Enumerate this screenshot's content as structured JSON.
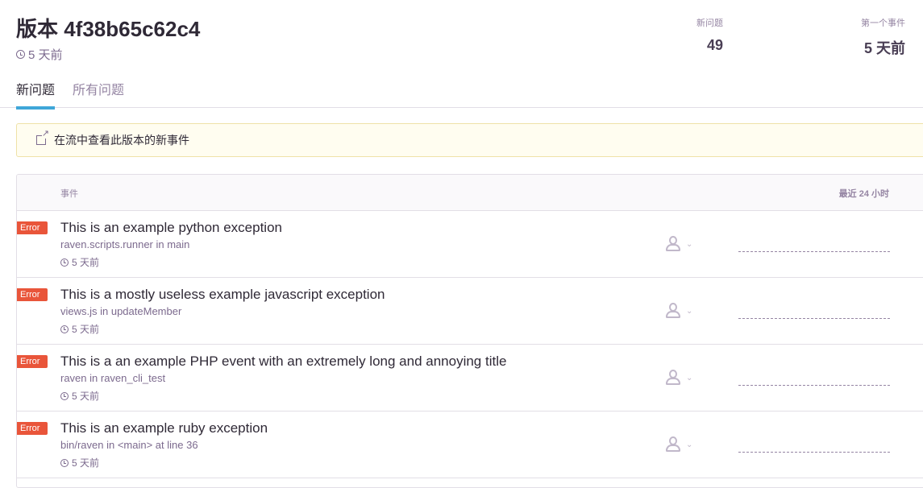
{
  "header": {
    "title": "版本 4f38b65c62c4",
    "time": "5 天前",
    "stats": {
      "new_issues_label": "新问题",
      "new_issues_value": "49",
      "first_event_label": "第一个事件",
      "first_event_value": "5 天前"
    }
  },
  "tabs": [
    {
      "label": "新问题",
      "active": true
    },
    {
      "label": "所有问题",
      "active": false
    }
  ],
  "alert": {
    "text": "在流中查看此版本的新事件",
    "icon": "external-link-icon"
  },
  "table": {
    "col_event": "事件",
    "col_graph": "最近 24 小时",
    "rows": [
      {
        "level": "Error",
        "title": "This is an example python exception",
        "culprit": "raven.scripts.runner in main",
        "time": "5 天前"
      },
      {
        "level": "Error",
        "title": "This is a mostly useless example javascript exception",
        "culprit": "views.js in updateMember",
        "time": "5 天前"
      },
      {
        "level": "Error",
        "title": "This is a an example PHP event with an extremely long and annoying title",
        "culprit": "raven in raven_cli_test",
        "time": "5 天前"
      },
      {
        "level": "Error",
        "title": "This is an example ruby exception",
        "culprit": "bin/raven in <main> at line 36",
        "time": "5 天前"
      }
    ]
  },
  "colors": {
    "error_badge": "#e9553a",
    "active_tab": "#3fa6d8",
    "alert_bg": "#fffdf0"
  }
}
